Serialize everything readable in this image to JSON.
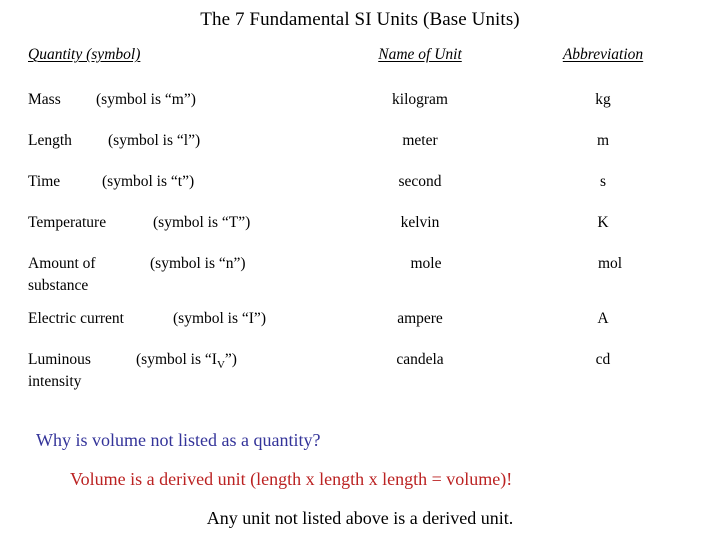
{
  "slide": {
    "title": "The 7 Fundamental SI Units (Base Units)",
    "background_color": "#ffffff",
    "text_color": "#000000"
  },
  "table": {
    "headers": {
      "quantity": "Quantity (symbol)",
      "unit": "Name of Unit",
      "abbreviation": "Abbreviation"
    },
    "rows": [
      {
        "quantity": "Mass",
        "quantity_line2": "",
        "symbol_text": "(symbol is “m”)",
        "symbol": "m",
        "unit": "kilogram",
        "abbreviation": "kg"
      },
      {
        "quantity": "Length",
        "quantity_line2": "",
        "symbol_text": "(symbol is “l”)",
        "symbol": "l",
        "unit": "meter",
        "abbreviation": "m"
      },
      {
        "quantity": "Time",
        "quantity_line2": "",
        "symbol_text": "(symbol is “t”)",
        "symbol": "t",
        "unit": "second",
        "abbreviation": "s"
      },
      {
        "quantity": "Temperature",
        "quantity_line2": "",
        "symbol_text": "(symbol is “T”)",
        "symbol": "T",
        "unit": "kelvin",
        "abbreviation": "K"
      },
      {
        "quantity": "Amount of",
        "quantity_line2": "substance",
        "symbol_text": "(symbol is “n”)",
        "symbol": "n",
        "unit": "mole",
        "abbreviation": "mol"
      },
      {
        "quantity": "Electric current",
        "quantity_line2": "",
        "symbol_text": "(symbol is “I”)",
        "symbol": "I",
        "unit": "ampere",
        "abbreviation": "A"
      },
      {
        "quantity": "Luminous",
        "quantity_line2": "intensity",
        "symbol_text_prefix": "(symbol is “I",
        "symbol_subscript": "V",
        "symbol_text_suffix": "”)",
        "symbol": "IV",
        "unit": "candela",
        "abbreviation": "cd"
      }
    ]
  },
  "notes": {
    "question": "Why is volume not listed as a quantity?",
    "question_color": "#333399",
    "answer": "Volume is a derived unit (length x length x length = volume)!",
    "answer_color": "#bb2222",
    "closing": "Any unit not listed above is a derived unit.",
    "closing_color": "#000000"
  }
}
